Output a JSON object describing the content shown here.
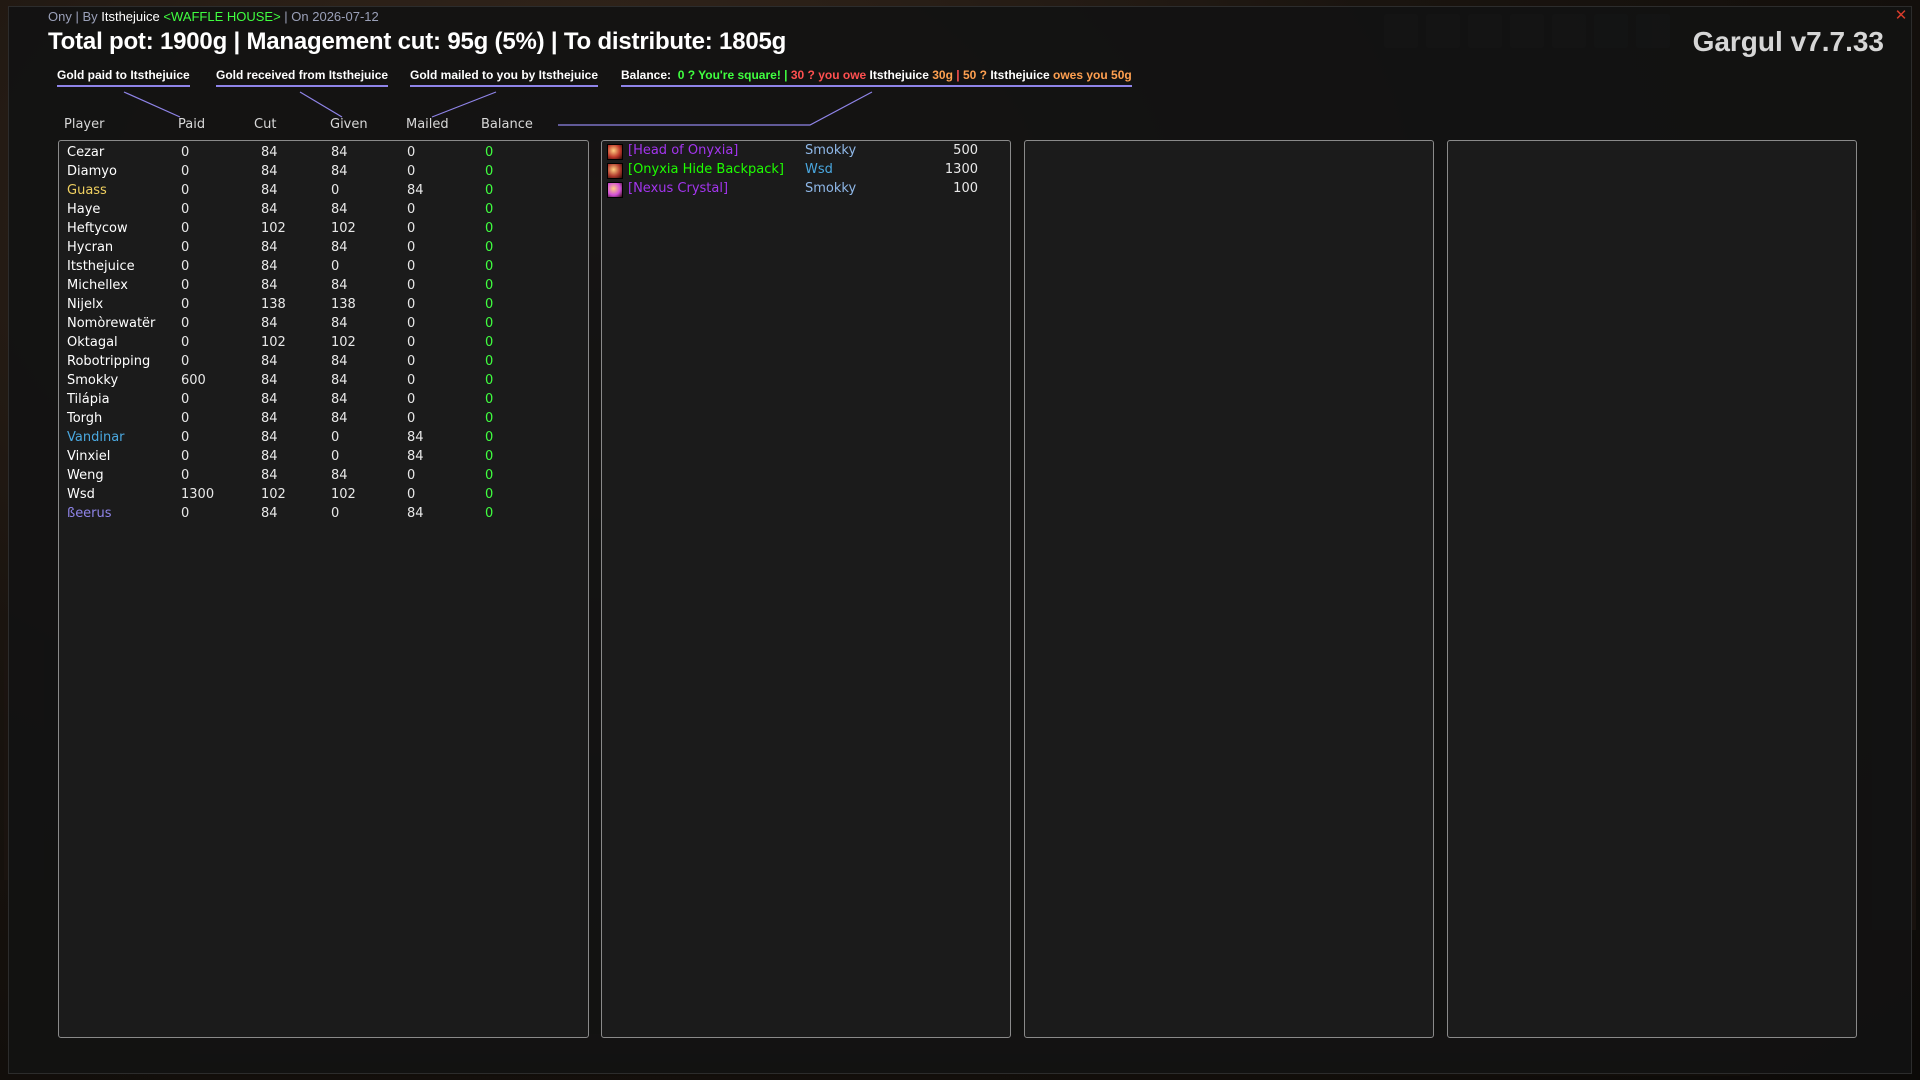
{
  "window": {
    "line1": {
      "prefix": "Ony | By ",
      "leader": "Itsthejuice",
      "guild": "<WAFFLE HOUSE>",
      "suffix": " | On 2026-07-12"
    },
    "headline": "Total pot: 1900g | Management cut: 95g (5%) | To distribute: 1805g",
    "brand": "Gargul v7.7.33",
    "close_glyph": "✕"
  },
  "legend": {
    "paid": "Gold paid to Itsthejuice",
    "received": "Gold received from Itsthejuice",
    "mailed": "Gold mailed to you by Itsthejuice",
    "balance_label": "Balance:",
    "square": "0 ? You're square!",
    "sep": "|",
    "owe_prefix": "30 ? you owe ",
    "owe_name": "Itsthejuice",
    "owe_amount": " 30g",
    "owes_prefix": "50 ? ",
    "owes_name": "Itsthejuice",
    "owes_suffix": " owes you 50g"
  },
  "columns": {
    "player": "Player",
    "paid": "Paid",
    "cut": "Cut",
    "given": "Given",
    "mailed": "Mailed",
    "balance": "Balance"
  },
  "players": [
    {
      "name": "Cezar",
      "color": "#ffffff",
      "paid": "0",
      "cut": "84",
      "given": "84",
      "mailed": "0",
      "balance": "0"
    },
    {
      "name": "Diamyo",
      "color": "#ffffff",
      "paid": "0",
      "cut": "84",
      "given": "84",
      "mailed": "0",
      "balance": "0"
    },
    {
      "name": "Guass",
      "color": "#f0d060",
      "paid": "0",
      "cut": "84",
      "given": "0",
      "mailed": "84",
      "balance": "0"
    },
    {
      "name": "Haye",
      "color": "#ffffff",
      "paid": "0",
      "cut": "84",
      "given": "84",
      "mailed": "0",
      "balance": "0"
    },
    {
      "name": "Heftycow",
      "color": "#ffffff",
      "paid": "0",
      "cut": "102",
      "given": "102",
      "mailed": "0",
      "balance": "0"
    },
    {
      "name": "Hycran",
      "color": "#ffffff",
      "paid": "0",
      "cut": "84",
      "given": "84",
      "mailed": "0",
      "balance": "0"
    },
    {
      "name": "Itsthejuice",
      "color": "#ffffff",
      "paid": "0",
      "cut": "84",
      "given": "0",
      "mailed": "0",
      "balance": "0"
    },
    {
      "name": "Michellex",
      "color": "#ffffff",
      "paid": "0",
      "cut": "84",
      "given": "84",
      "mailed": "0",
      "balance": "0"
    },
    {
      "name": "Nijelx",
      "color": "#ffffff",
      "paid": "0",
      "cut": "138",
      "given": "138",
      "mailed": "0",
      "balance": "0"
    },
    {
      "name": "Nomòrewatër",
      "color": "#ffffff",
      "paid": "0",
      "cut": "84",
      "given": "84",
      "mailed": "0",
      "balance": "0"
    },
    {
      "name": "Oktagal",
      "color": "#ffffff",
      "paid": "0",
      "cut": "102",
      "given": "102",
      "mailed": "0",
      "balance": "0"
    },
    {
      "name": "Robotripping",
      "color": "#ffffff",
      "paid": "0",
      "cut": "84",
      "given": "84",
      "mailed": "0",
      "balance": "0"
    },
    {
      "name": "Smokky",
      "color": "#ffffff",
      "paid": "600",
      "cut": "84",
      "given": "84",
      "mailed": "0",
      "balance": "0"
    },
    {
      "name": "Tilápia",
      "color": "#ffffff",
      "paid": "0",
      "cut": "84",
      "given": "84",
      "mailed": "0",
      "balance": "0"
    },
    {
      "name": "Torgh",
      "color": "#ffffff",
      "paid": "0",
      "cut": "84",
      "given": "84",
      "mailed": "0",
      "balance": "0"
    },
    {
      "name": "Vandinar",
      "color": "#4aa8e0",
      "paid": "0",
      "cut": "84",
      "given": "0",
      "mailed": "84",
      "balance": "0"
    },
    {
      "name": "Vinxiel",
      "color": "#ffffff",
      "paid": "0",
      "cut": "84",
      "given": "0",
      "mailed": "84",
      "balance": "0"
    },
    {
      "name": "Weng",
      "color": "#ffffff",
      "paid": "0",
      "cut": "84",
      "given": "84",
      "mailed": "0",
      "balance": "0"
    },
    {
      "name": "Wsd",
      "color": "#ffffff",
      "paid": "1300",
      "cut": "102",
      "given": "102",
      "mailed": "0",
      "balance": "0"
    },
    {
      "name": "ßeerus",
      "color": "#8f84e8",
      "paid": "0",
      "cut": "84",
      "given": "0",
      "mailed": "84",
      "balance": "0"
    }
  ],
  "items": [
    {
      "name": "[Head of Onyxia]",
      "color": "#a335ee",
      "winner": "Smokky",
      "winner_color": "#8fb8e8",
      "price": "500",
      "icon": "onyxia-head-icon",
      "icon_color": "#c0392b"
    },
    {
      "name": "[Onyxia Hide Backpack]",
      "color": "#1eff00",
      "winner": "Wsd",
      "winner_color": "#4aa8e0",
      "price": "1300",
      "icon": "backpack-icon",
      "icon_color": "#b03a2e"
    },
    {
      "name": "[Nexus Crystal]",
      "color": "#a335ee",
      "winner": "Smokky",
      "winner_color": "#8fb8e8",
      "price": "100",
      "icon": "crystal-icon",
      "icon_color": "#d24fd8"
    }
  ]
}
